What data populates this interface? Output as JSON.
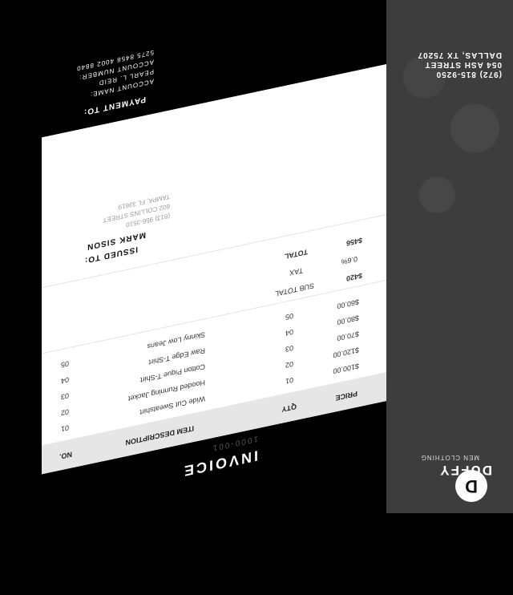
{
  "brand": {
    "logo_letter": "D",
    "name": "DUFFY",
    "tagline": "MEN CLOTHING",
    "phone": "(972) 815-9250",
    "street": "054 ASH STREET",
    "city": "DALLAS, TX 75207"
  },
  "invoice": {
    "title": "INVOICE",
    "number": "1000-001"
  },
  "table": {
    "headers": {
      "no": "NO.",
      "description": "ITEM DESCRIPTION",
      "qty": "QTY",
      "price": "PRICE"
    },
    "rows": [
      {
        "no": "01",
        "description": "Wide Cut Sweatshirt",
        "qty": "01",
        "price": "$100.00"
      },
      {
        "no": "02",
        "description": "Hooded Running Jacket",
        "qty": "02",
        "price": "$120.00"
      },
      {
        "no": "03",
        "description": "Cotton Pique T-Shirt",
        "qty": "03",
        "price": "$70.00"
      },
      {
        "no": "04",
        "description": "Raw Edge T-Shirt",
        "qty": "04",
        "price": "$80.00"
      },
      {
        "no": "05",
        "description": "Skinny Low Jeans",
        "qty": "05",
        "price": "$60.00"
      }
    ]
  },
  "summary": {
    "subtotal_label": "SUB TOTAL",
    "subtotal_value": "$420",
    "tax_label": "TAX",
    "tax_value": "0.6%",
    "total_label": "TOTAL",
    "total_value": "$456"
  },
  "issued_to": {
    "heading": "ISSUED TO:",
    "name": "MARK SISON",
    "phone": "(813) 956-3510",
    "street": "602 COLLINS STREET",
    "city": "TAMPA, FL 33619"
  },
  "payment": {
    "heading": "PAYMENT TO:",
    "account_name_label": "ACCOUNT NAME:",
    "account_name": "PEARL L. REID",
    "account_number_label": "ACCOUNT NUMBER:",
    "account_number": "5275 8458 4002 8840"
  }
}
